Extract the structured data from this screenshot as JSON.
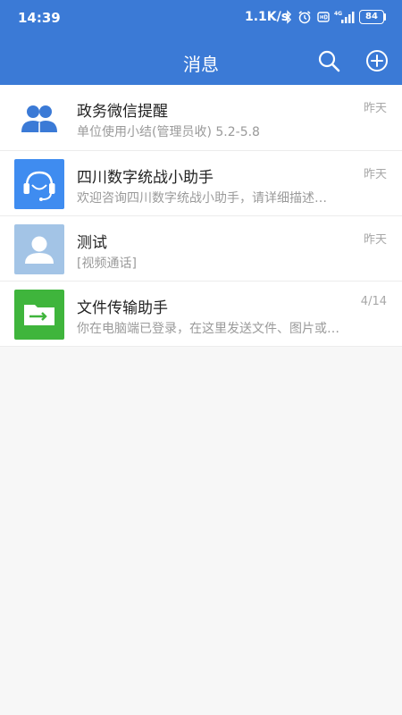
{
  "status_bar": {
    "time": "14:39",
    "net_speed": "1.1K/s",
    "battery": "84",
    "icons": [
      "bluetooth-icon",
      "alarm-icon",
      "hd-icon",
      "4g-signal-icon"
    ]
  },
  "header": {
    "title": "消息",
    "search_icon": "search-icon",
    "add_icon": "plus-circle-icon",
    "background": "#3b7ad6"
  },
  "conversations": [
    {
      "name": "政务微信提醒",
      "preview": "单位使用小结(管理员收) 5.2-5.8",
      "time": "昨天",
      "avatar_icon": "group-users-icon",
      "avatar_color": "#ffffff"
    },
    {
      "name": "四川数字统战小助手",
      "preview": "欢迎咨询四川数字统战小助手，请详细描述…",
      "time": "昨天",
      "avatar_icon": "headset-icon",
      "avatar_color": "#3f8cf0"
    },
    {
      "name": "测试",
      "preview": "[视频通话]",
      "time": "昨天",
      "avatar_icon": "user-icon",
      "avatar_color": "#a3c4e6"
    },
    {
      "name": "文件传输助手",
      "preview": "你在电脑端已登录，在这里发送文件、图片或…",
      "time": "4/14",
      "avatar_icon": "folder-transfer-icon",
      "avatar_color": "#3fb53c"
    }
  ]
}
